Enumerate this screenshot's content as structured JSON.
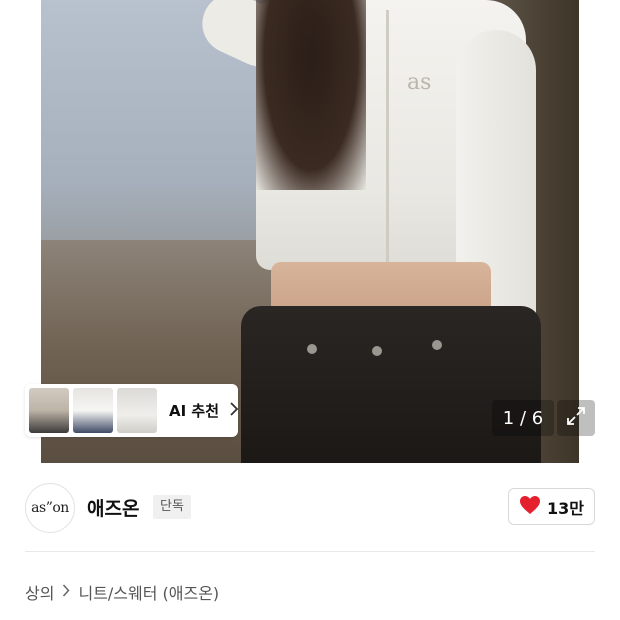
{
  "gallery": {
    "counter": "1 / 6",
    "expand_icon": "expand-arrows-icon",
    "ai_recommend": {
      "label": "AI 추천",
      "chevron_icon": "chevron-right-icon",
      "thumbnail_count": 3
    },
    "photo_logo_text": "as"
  },
  "brand": {
    "logo_text": "as”on",
    "name": "애즈온",
    "badge": "단독"
  },
  "like": {
    "icon": "heart-icon",
    "color": "#e5202e",
    "count": "13만"
  },
  "breadcrumb": {
    "items": [
      "상의",
      "니트/스웨터 (애즈온)"
    ],
    "separator_icon": "chevron-right-icon"
  }
}
